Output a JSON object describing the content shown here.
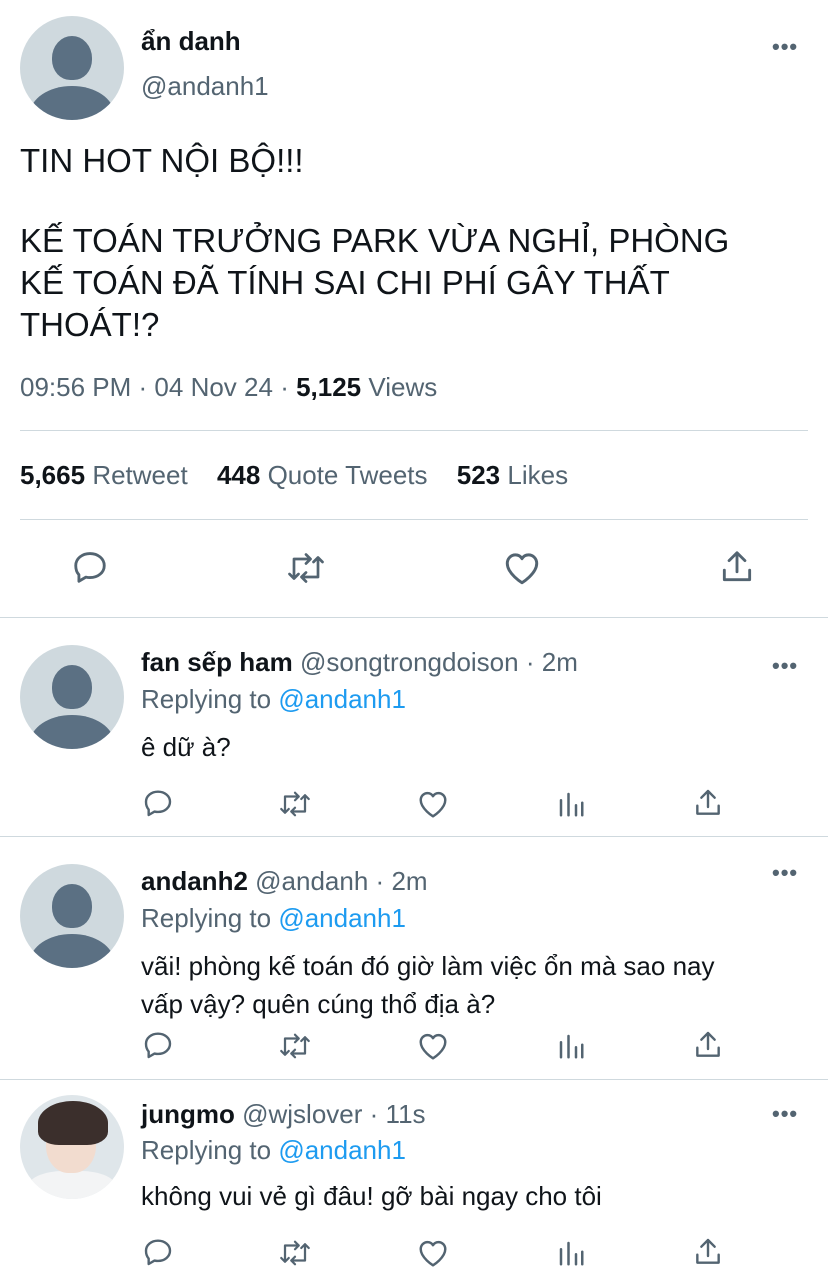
{
  "main": {
    "display_name": "ẩn danh",
    "handle": "@andanh1",
    "text_line1": "TIN HOT NỘI BỘ!!!",
    "text_line2": "KẾ TOÁN TRƯỞNG PARK VỪA NGHỈ, PHÒNG",
    "text_line3": "KẾ TOÁN ĐÃ TÍNH SAI CHI PHÍ GÂY THẤT",
    "text_line4": "THOÁT!?",
    "time": "09:56 PM",
    "date": "04 Nov 24",
    "views_count": "5,125",
    "views_label": "Views",
    "retweet_count": "5,665",
    "retweet_label": "Retweet",
    "quote_count": "448",
    "quote_label": "Quote Tweets",
    "likes_count": "523",
    "likes_label": "Likes"
  },
  "replies": [
    {
      "name": "fan sếp ham",
      "handle": "@songtrongdoison",
      "time": "2m",
      "replying_label": "Replying to",
      "replying_to": "@andanh1",
      "text_line1": "ê dữ à?",
      "text_line2": ""
    },
    {
      "name": "andanh2",
      "handle": "@andanh",
      "time": "2m",
      "replying_label": "Replying to",
      "replying_to": "@andanh1",
      "text_line1": "vãi! phòng kế toán đó giờ làm việc ổn mà sao nay",
      "text_line2": "vấp vậy? quên cúng thổ địa à?"
    },
    {
      "name": "jungmo",
      "handle": "@wjslover",
      "time": "11s",
      "replying_label": "Replying to",
      "replying_to": "@andanh1",
      "text_line1": "không vui vẻ gì đâu! gỡ bài ngay cho tôi",
      "text_line2": ""
    }
  ],
  "icons": {
    "reply": "reply-icon",
    "retweet": "retweet-icon",
    "like": "heart-icon",
    "share": "share-icon",
    "views": "analytics-icon",
    "more": "more-icon"
  },
  "colors": {
    "text": "#0f1419",
    "secondary": "#536471",
    "mention": "#1d9bf0",
    "divider": "#cfd9de"
  }
}
